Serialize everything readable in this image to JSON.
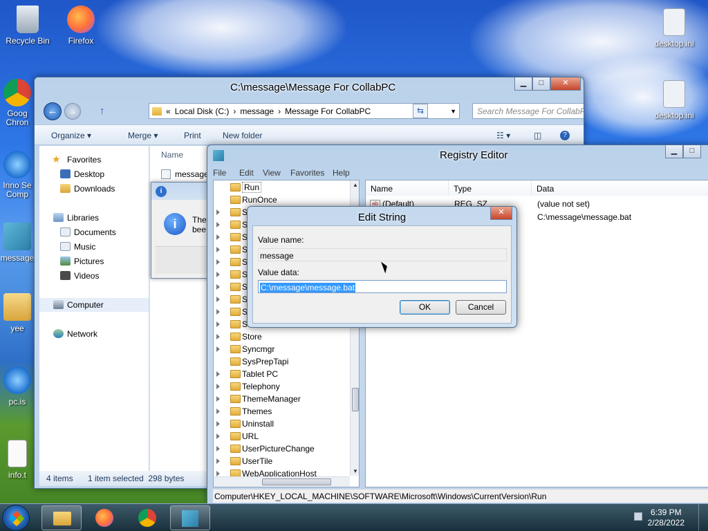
{
  "desktop": {
    "icons": [
      {
        "label": "Recycle Bin"
      },
      {
        "label": "Firefox"
      },
      {
        "label": "Goog Chron"
      },
      {
        "label": "Inno Se Comp"
      },
      {
        "label": "message"
      },
      {
        "label": "yee"
      },
      {
        "label": "pc.is"
      },
      {
        "label": "info.t"
      },
      {
        "label": "desktop.ini"
      },
      {
        "label": "desktop.ini"
      }
    ]
  },
  "explorer": {
    "title": "C:\\message\\Message For CollabPC",
    "breadcrumb": [
      "«",
      "Local Disk (C:)",
      "message",
      "Message For CollabPC"
    ],
    "search_placeholder": "Search Message For CollabPC",
    "toolbar": {
      "organize": "Organize ▾",
      "merge": "Merge ▾",
      "print": "Print",
      "new_folder": "New folder"
    },
    "nav": {
      "favorites": "Favorites",
      "desktop": "Desktop",
      "downloads": "Downloads",
      "libraries": "Libraries",
      "documents": "Documents",
      "music": "Music",
      "pictures": "Pictures",
      "videos": "Videos",
      "computer": "Computer",
      "network": "Network"
    },
    "column_name": "Name",
    "file_name": "message",
    "status_items": "4 items",
    "status_selected": "1 item selected  298 bytes"
  },
  "info_dialog": {
    "text_line1": "The",
    "text_line2": "bee"
  },
  "regedit": {
    "title": "Registry Editor",
    "menu": [
      "File",
      "Edit",
      "View",
      "Favorites",
      "Help"
    ],
    "tree": [
      "Run",
      "RunOnce",
      "S",
      "S",
      "S",
      "S",
      "S",
      "S",
      "S",
      "S",
      "S",
      "S",
      "Store",
      "Syncmgr",
      "SysPrepTapi",
      "Tablet PC",
      "Telephony",
      "ThemeManager",
      "Themes",
      "Uninstall",
      "URL",
      "UserPictureChange",
      "UserTile",
      "WebApplicationHost"
    ],
    "columns": {
      "name": "Name",
      "type": "Type",
      "data": "Data"
    },
    "values": [
      {
        "name": "(Default)",
        "type": "REG_SZ",
        "data": "(value not set)"
      },
      {
        "name": "",
        "type": "",
        "data": "C:\\message\\message.bat"
      }
    ],
    "status_path": "Computer\\HKEY_LOCAL_MACHINE\\SOFTWARE\\Microsoft\\Windows\\CurrentVersion\\Run"
  },
  "edit_string": {
    "title": "Edit String",
    "value_name_label": "Value name:",
    "value_name": "message",
    "value_data_label": "Value data:",
    "value_data": "C:\\message\\message.bat",
    "ok": "OK",
    "cancel": "Cancel"
  },
  "taskbar": {
    "time": "6:39 PM",
    "date": "2/28/2022"
  }
}
